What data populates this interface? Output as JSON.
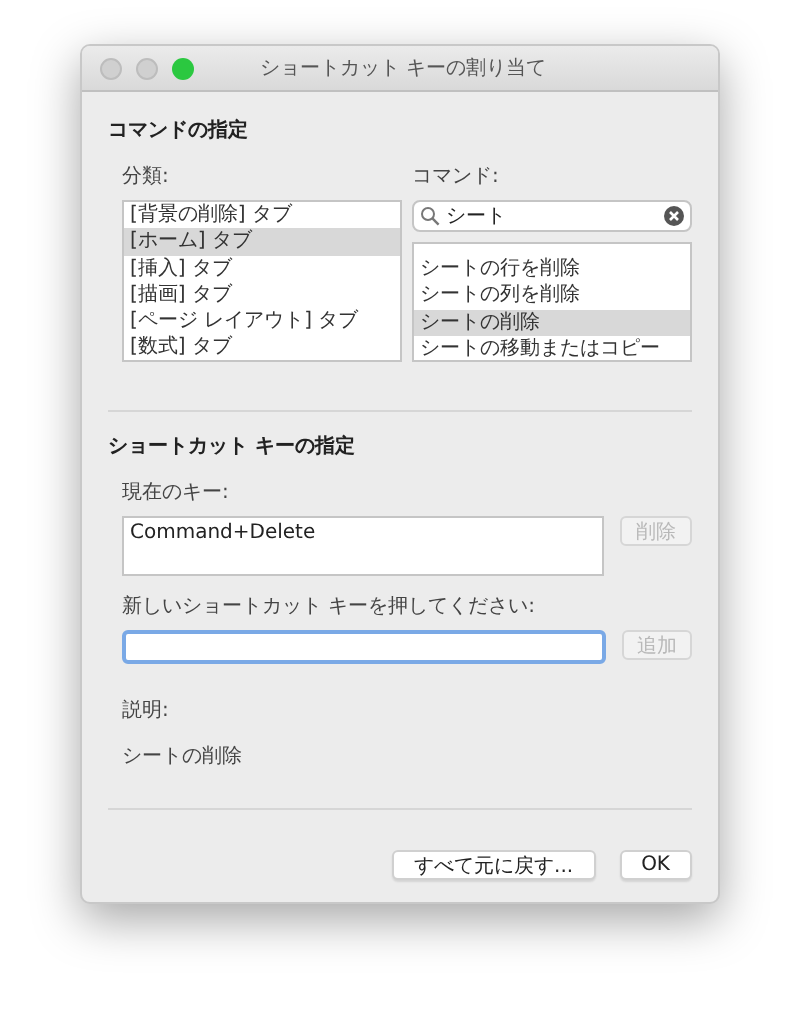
{
  "window": {
    "title": "ショートカット キーの割り当て"
  },
  "command_section": {
    "heading": "コマンドの指定",
    "categories_label": "分類:",
    "commands_label": "コマンド:",
    "categories": [
      {
        "label": "[背景の削除] タブ",
        "selected": false
      },
      {
        "label": "[ホーム] タブ",
        "selected": true
      },
      {
        "label": "[挿入] タブ",
        "selected": false
      },
      {
        "label": "[描画] タブ",
        "selected": false
      },
      {
        "label": "[ページ レイアウト] タブ",
        "selected": false
      },
      {
        "label": "[数式] タブ",
        "selected": false
      }
    ],
    "search": {
      "value": "シート"
    },
    "commands": [
      {
        "label": "シートの行を削除",
        "selected": false
      },
      {
        "label": "シートの列を削除",
        "selected": false
      },
      {
        "label": "シートの削除",
        "selected": true
      },
      {
        "label": "シートの移動またはコピー",
        "selected": false
      }
    ]
  },
  "shortcut_section": {
    "heading": "ショートカット キーの指定",
    "current_keys_label": "現在のキー:",
    "current_keys": "Command+Delete",
    "remove_button": {
      "label": "削除",
      "disabled": true
    },
    "new_key_label": "新しいショートカット キーを押してください:",
    "add_button": {
      "label": "追加",
      "disabled": true
    }
  },
  "description": {
    "label": "説明:",
    "text": "シートの削除"
  },
  "buttons": [
    {
      "label": "すべて元に戻す..."
    },
    {
      "label": "OK"
    }
  ]
}
